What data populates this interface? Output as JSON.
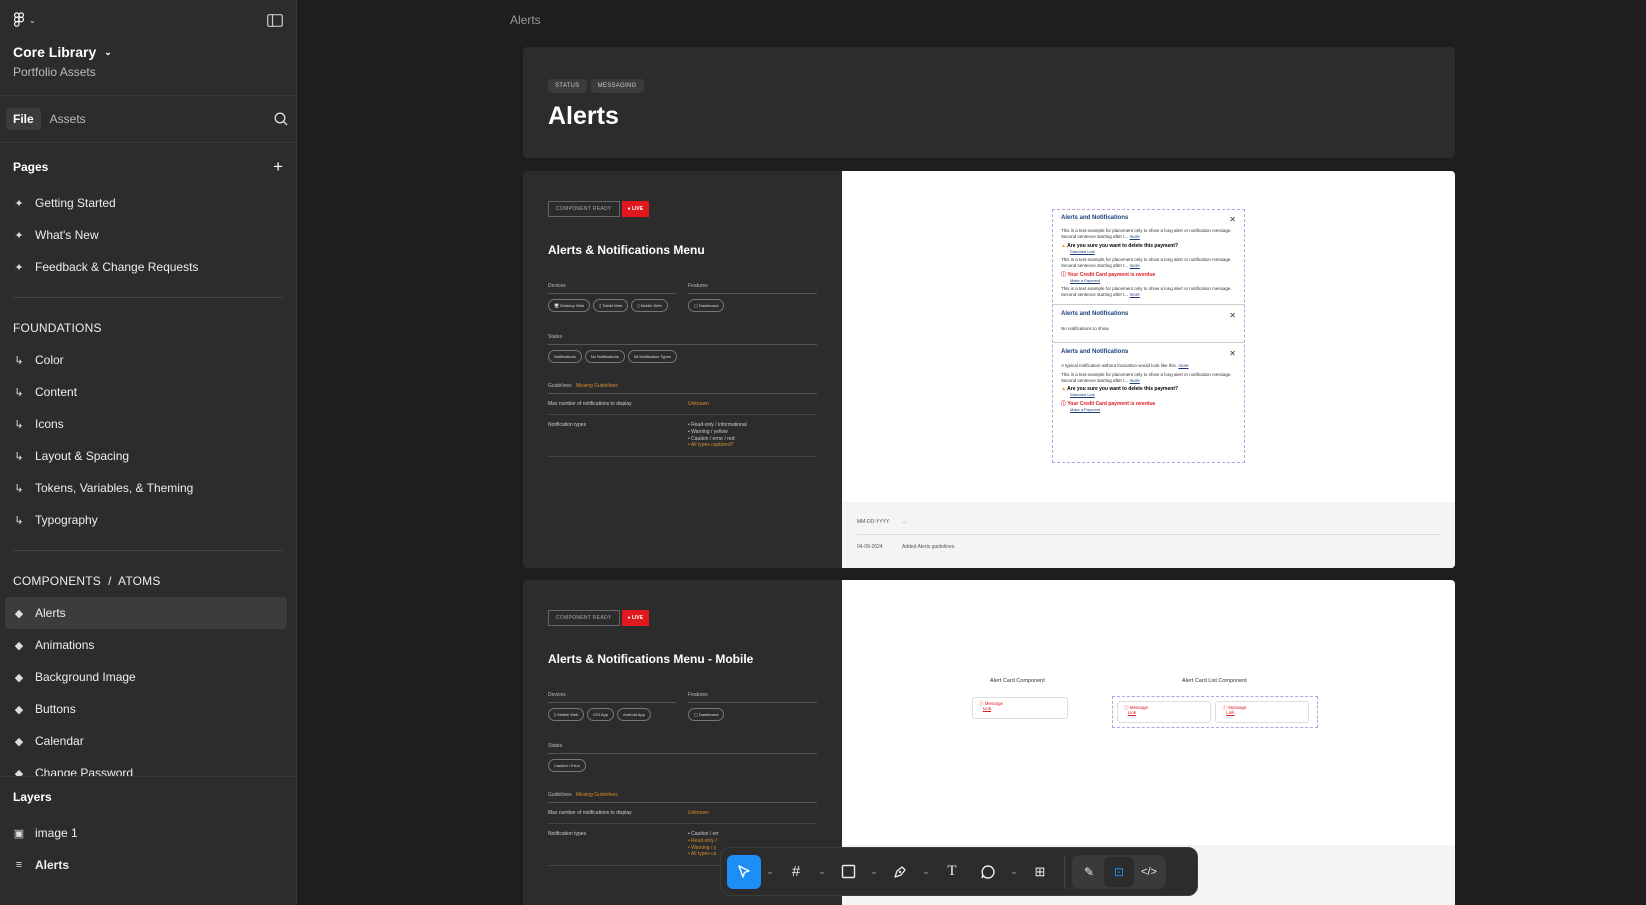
{
  "sidebar": {
    "project_name": "Core Library",
    "project_sub": "Portfolio Assets",
    "tabs": [
      "File",
      "Assets"
    ],
    "pages_heading": "Pages",
    "pages": [
      "Getting Started",
      "What's New",
      "Feedback & Change Requests"
    ],
    "foundations_heading": "FOUNDATIONS",
    "foundations": [
      "Color",
      "Content",
      "Icons",
      "Layout & Spacing",
      "Tokens, Variables, & Theming",
      "Typography"
    ],
    "components_heading": "COMPONENTS  /  ATOMS",
    "components": [
      "Alerts",
      "Animations",
      "Background Image",
      "Buttons",
      "Calendar",
      "Change Password"
    ],
    "layers_heading": "Layers",
    "layers": [
      "image 1",
      "Alerts"
    ]
  },
  "canvas": {
    "breadcrumb": "Alerts",
    "header": {
      "tags": [
        "STATUS",
        "MESSAGING"
      ],
      "title": "Alerts"
    },
    "card1": {
      "status": "COMPONENT READY",
      "live": "● LIVE",
      "title": "Alerts & Notifications Menu",
      "devices_label": "Devices",
      "features_label": "Features",
      "devices": [
        "🖥 Desktop Web",
        "▯ Tablet Web",
        "▯ Mobile Web"
      ],
      "features": [
        "▢ Dashboard"
      ],
      "states_label": "States",
      "states": [
        "Notifications",
        "No Notifications",
        "All Notification Types"
      ],
      "guidelines_label": "Guidelines",
      "guidelines_status": "Missing Guidelines",
      "max_label": "Max number of notifications to display",
      "max_value": "Unknown",
      "types_label": "Notification types",
      "types": [
        "Read-only / informational",
        "Warning / yellow",
        "Caution / error / red"
      ],
      "types_q": "All types captured?",
      "changelog": [
        {
          "date": "MM-DD-YYYY",
          "note": "..."
        },
        {
          "date": "04-09-2024",
          "note": "Added Alerts guidelines."
        }
      ],
      "panel_title": "Alerts and Notifications",
      "panel_text": "This is a text example for placement only to show a long alert or notification message. Second sentence starting after t...",
      "more": "more",
      "warn_title": "Are you sure you want to delete this payment?",
      "std_link": "Standard Link",
      "error_title": "Your Credit Card payment is overdue",
      "pay_link": "Make a Payment",
      "empty_text": "No notifications to show.",
      "typical_text": "A typical notification without truncation would look like this."
    },
    "card2": {
      "status": "COMPONENT READY",
      "live": "● LIVE",
      "title": "Alerts & Notifications Menu - Mobile",
      "devices_label": "Devices",
      "features_label": "Features",
      "devices": [
        "▯ Mobile Web",
        "iOS App",
        "Android App"
      ],
      "features": [
        "▢ Dashboard"
      ],
      "states_label": "States",
      "states": [
        "Caution / Error"
      ],
      "guidelines_label": "Guidelines",
      "guidelines_status": "Missing Guidelines",
      "max_label": "Max number of notifications to display",
      "max_value": "Unknown",
      "types_label": "Notification types",
      "types": [
        "Caution / err",
        "Read-only /",
        "Warning / y"
      ],
      "types_q": "All types ca",
      "card_label": "Alert Card Component",
      "list_label": "Alert Card List Component",
      "msg": "Message",
      "link": "Link"
    }
  },
  "toolbar": {
    "accent": "#1d8ef5"
  },
  "colors": {
    "live": "#e0191f",
    "orange": "#d48d2d",
    "link": "#1a3d7a",
    "error": "#e0191f"
  }
}
